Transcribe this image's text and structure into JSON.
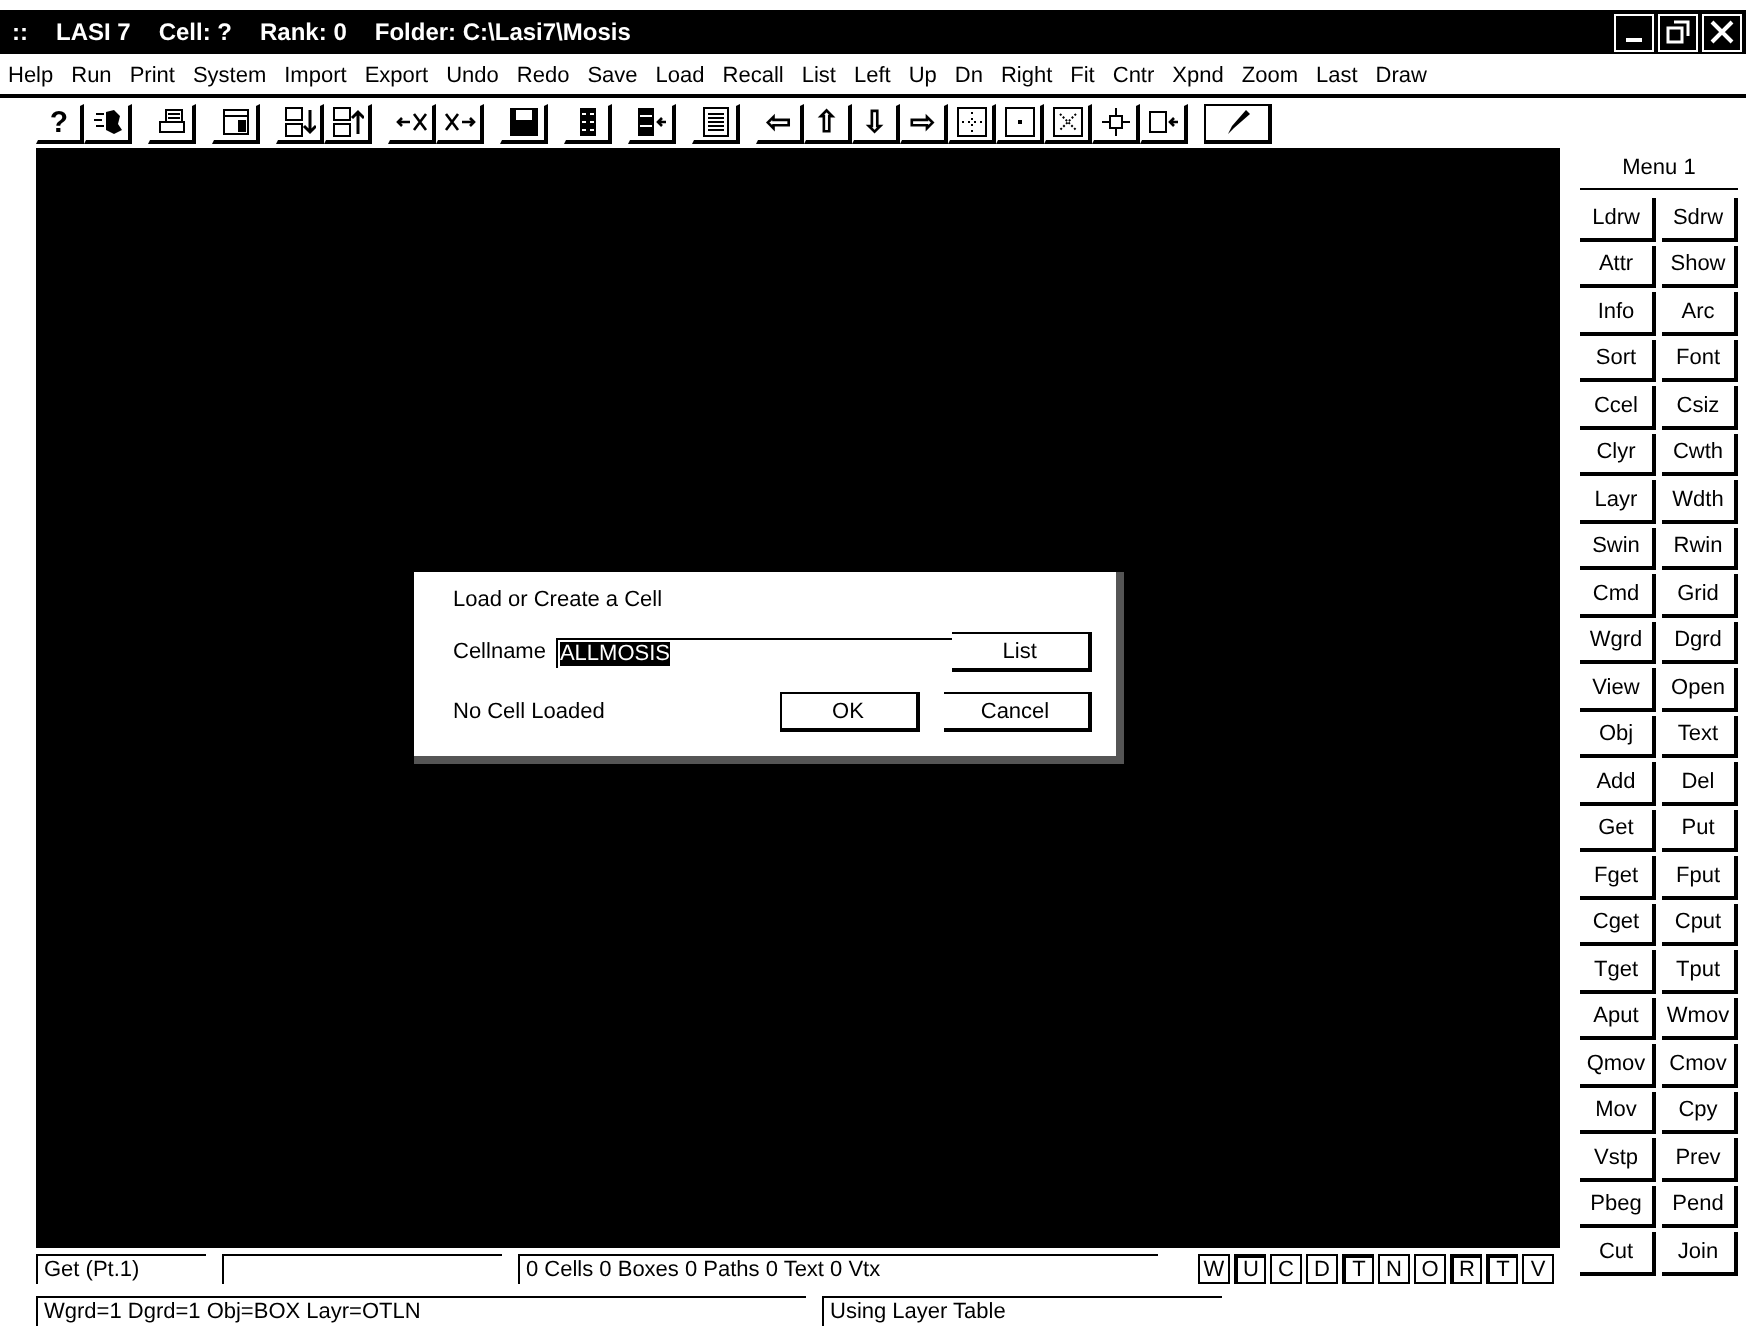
{
  "window": {
    "title_parts": [
      "::",
      "LASI 7",
      "Cell: ?",
      "Rank: 0",
      "Folder: C:\\Lasi7\\Mosis"
    ]
  },
  "menu": [
    "Help",
    "Run",
    "Print",
    "System",
    "Import",
    "Export",
    "Undo",
    "Redo",
    "Save",
    "Load",
    "Recall",
    "List",
    "Left",
    "Up",
    "Dn",
    "Right",
    "Fit",
    "Cntr",
    "Xpnd",
    "Zoom",
    "Last",
    "Draw"
  ],
  "toolbar": [
    {
      "kind": "text",
      "label": "?"
    },
    {
      "kind": "splat"
    },
    {
      "kind": "printer"
    },
    {
      "kind": "window"
    },
    {
      "kind": "stack-down"
    },
    {
      "kind": "stack-up"
    },
    {
      "kind": "arrow-x"
    },
    {
      "kind": "x-arrow"
    },
    {
      "kind": "floppy"
    },
    {
      "kind": "chip"
    },
    {
      "kind": "chip-arrow"
    },
    {
      "kind": "lines"
    },
    {
      "kind": "text",
      "label": "⇦"
    },
    {
      "kind": "text",
      "label": "⇧"
    },
    {
      "kind": "text",
      "label": "⇩"
    },
    {
      "kind": "text",
      "label": "⇨"
    },
    {
      "kind": "fit"
    },
    {
      "kind": "center"
    },
    {
      "kind": "expand"
    },
    {
      "kind": "move"
    },
    {
      "kind": "box-arrow"
    },
    {
      "kind": "pen",
      "selected": true
    }
  ],
  "side_panel": {
    "title": "Menu 1",
    "buttons": [
      "Ldrw",
      "Sdrw",
      "Attr",
      "Show",
      "Info",
      "Arc",
      "Sort",
      "Font",
      "Ccel",
      "Csiz",
      "Clyr",
      "Cwth",
      "Layr",
      "Wdth",
      "Swin",
      "Rwin",
      "Cmd",
      "Grid",
      "Wgrd",
      "Dgrd",
      "View",
      "Open",
      "Obj",
      "Text",
      "Add",
      "Del",
      "Get",
      "Put",
      "Fget",
      "Fput",
      "Cget",
      "Cput",
      "Tget",
      "Tput",
      "Aput",
      "Wmov",
      "Qmov",
      "Cmov",
      "Mov",
      "Cpy",
      "Vstp",
      "Prev",
      "Pbeg",
      "Pend",
      "Cut",
      "Join"
    ]
  },
  "dialog": {
    "title": "Load or Create a Cell",
    "field_label": "Cellname",
    "value": "ALLMOSIS",
    "list_button": "List",
    "status": "No Cell Loaded",
    "ok": "OK",
    "cancel": "Cancel"
  },
  "status_bar": {
    "command": "Get  (Pt.1)",
    "counts": "0 Cells  0 Boxes  0 Paths  0 Text  0 Vtx",
    "settings": "Wgrd=1  Dgrd=1  Obj=BOX  Layr=OTLN",
    "layer_info": "Using Layer Table",
    "toggles": [
      {
        "label": "W",
        "on": false
      },
      {
        "label": "U",
        "on": true
      },
      {
        "label": "C",
        "on": false
      },
      {
        "label": "D",
        "on": false
      },
      {
        "label": "T",
        "on": true
      },
      {
        "label": "N",
        "on": false
      },
      {
        "label": "O",
        "on": false
      },
      {
        "label": "R",
        "on": true
      },
      {
        "label": "T",
        "on": true
      },
      {
        "label": "V",
        "on": false
      }
    ]
  }
}
